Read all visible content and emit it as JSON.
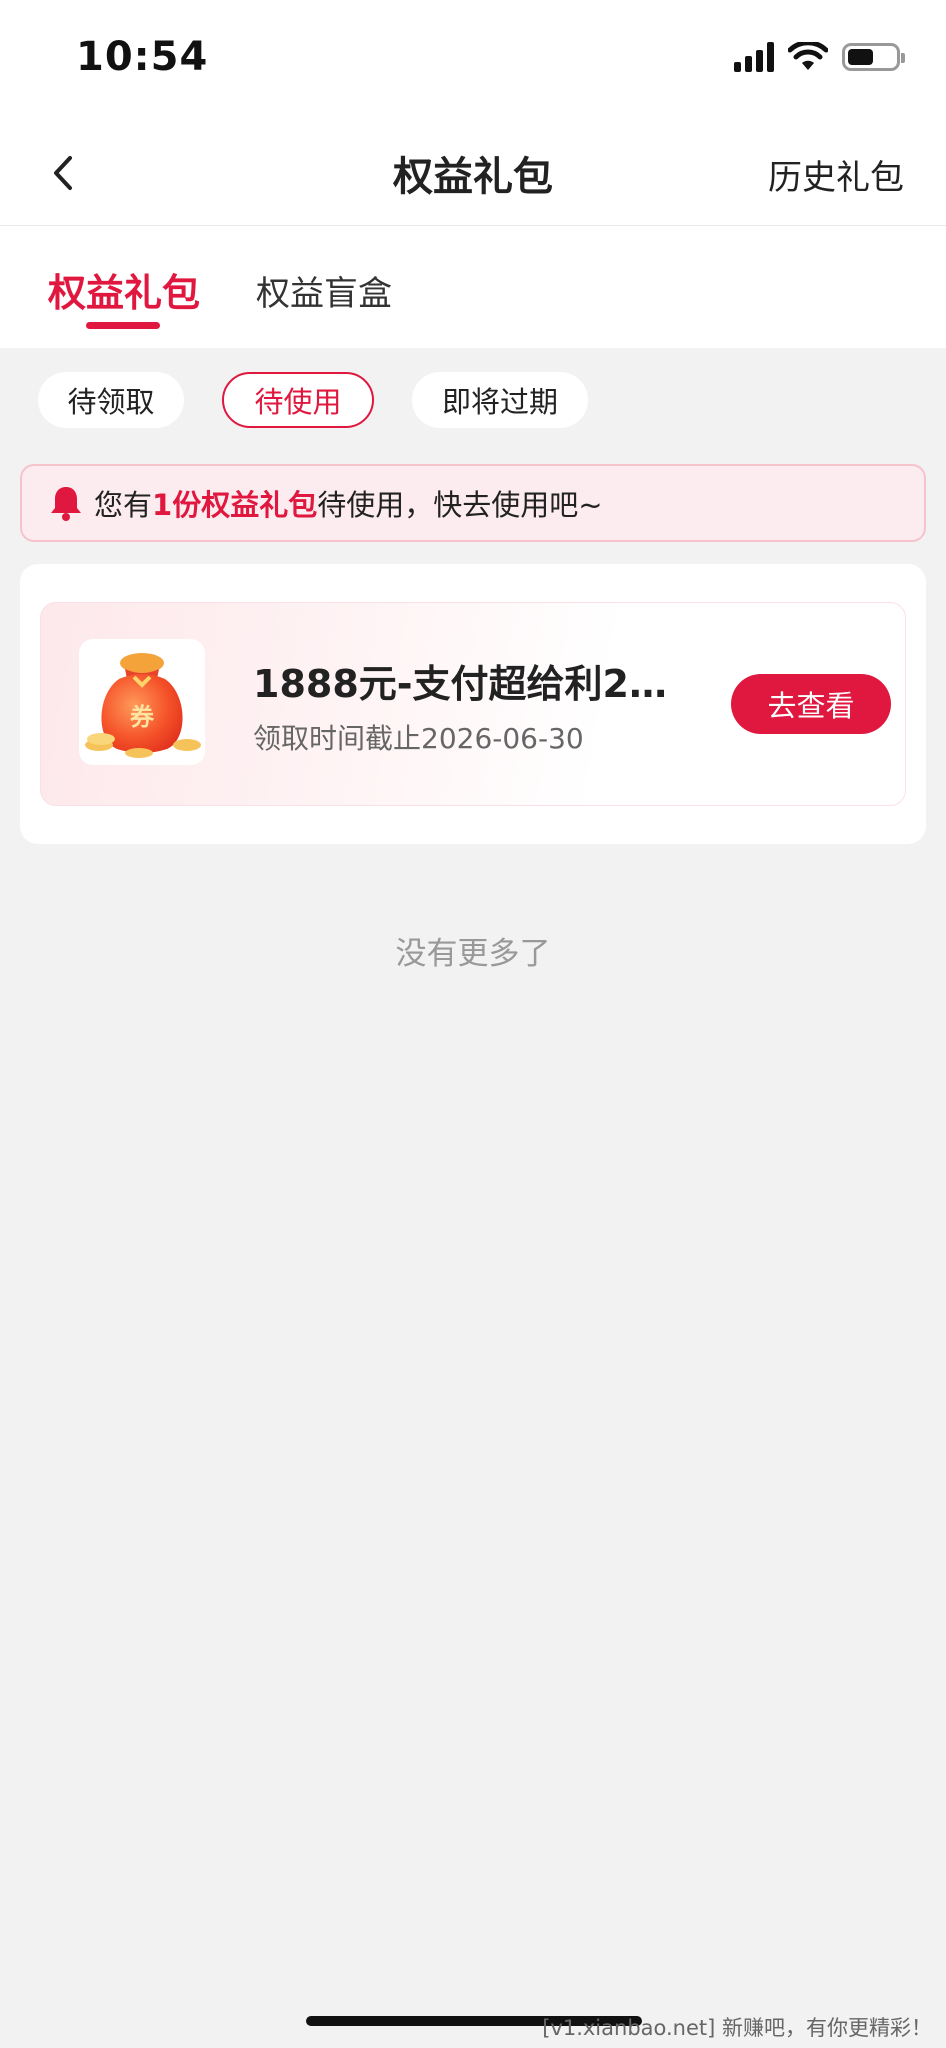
{
  "status_bar": {
    "time": "10:54",
    "battery_level": 0.55
  },
  "nav": {
    "title": "权益礼包",
    "history_label": "历史礼包"
  },
  "top_tabs": [
    {
      "label": "权益礼包",
      "active": true
    },
    {
      "label": "权益盲盒",
      "active": false
    }
  ],
  "filters": [
    {
      "label": "待领取",
      "active": false
    },
    {
      "label": "待使用",
      "active": true
    },
    {
      "label": "即将过期",
      "active": false
    }
  ],
  "notice": {
    "prefix": "您有",
    "highlight": "1份权益礼包",
    "suffix": "待使用，快去使用吧~"
  },
  "gifts": [
    {
      "title": "1888元-支付超给利2…",
      "date": "领取时间截止2026-06-30",
      "badge_char": "券",
      "button_label": "去查看"
    }
  ],
  "footer_text": "没有更多了",
  "watermark": "[v1.xianbao.net] 新赚吧，有你更精彩！",
  "colors": {
    "accent": "#e0173e",
    "background": "#f2f2f2"
  }
}
